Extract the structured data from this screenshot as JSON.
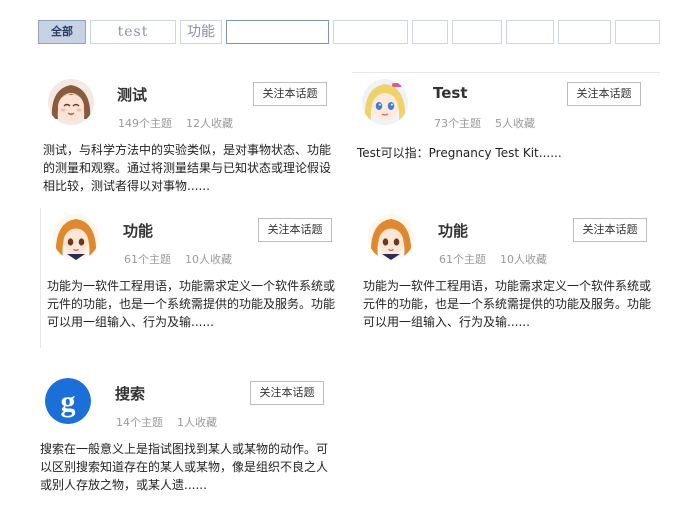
{
  "tabs": [
    {
      "label": "全部"
    },
    {
      "label": "test"
    },
    {
      "label": "功能"
    },
    {
      "label": ""
    },
    {
      "label": ""
    },
    {
      "label": ""
    },
    {
      "label": ""
    },
    {
      "label": ""
    },
    {
      "label": ""
    },
    {
      "label": ""
    }
  ],
  "cards": [
    {
      "title": "测试",
      "topics": "149个主题",
      "favorites": "12人收藏",
      "follow_label": "关注本话题",
      "description": "测试，与科学方法中的实验类似，是对事物状态、功能的测量和观察。通过将测量结果与已知状态或理论假设相比较，测试者得以对事物......",
      "avatar_icon": "anime-girl-brown-hair-icon"
    },
    {
      "title": "Test",
      "topics": "73个主题",
      "favorites": "5人收藏",
      "follow_label": "关注本话题",
      "description": "Test可以指：Pregnancy Test Kit......",
      "avatar_icon": "anime-girl-blonde-hair-icon"
    },
    {
      "title": "功能",
      "topics": "61个主题",
      "favorites": "10人收藏",
      "follow_label": "关注本话题",
      "description": "功能为一软件工程用语，功能需求定义一个软件系统或元件的功能，也是一个系统需提供的功能及服务。功能可以用一组输入、行为及输......",
      "avatar_icon": "anime-girl-orange-hair-icon"
    },
    {
      "title": "功能",
      "topics": "61个主题",
      "favorites": "10人收藏",
      "follow_label": "关注本话题",
      "description": "功能为一软件工程用语，功能需求定义一个软件系统或元件的功能，也是一个系统需提供的功能及服务。功能可以用一组输入、行为及输......",
      "avatar_icon": "anime-girl-orange-hair-icon"
    },
    {
      "title": "搜索",
      "topics": "14个主题",
      "favorites": "1人收藏",
      "follow_label": "关注本话题",
      "description": "搜索在一般意义上是指试图找到某人或某物的动作。可以区别搜索知道存在的某人或某物，像是组织不良之人或别人存放之物，或某人遗......",
      "avatar_icon": "google-g-logo-icon"
    }
  ],
  "colors": {
    "active_tab_bg": "#c7d3e4",
    "google_blue": "#1a6fd8"
  }
}
